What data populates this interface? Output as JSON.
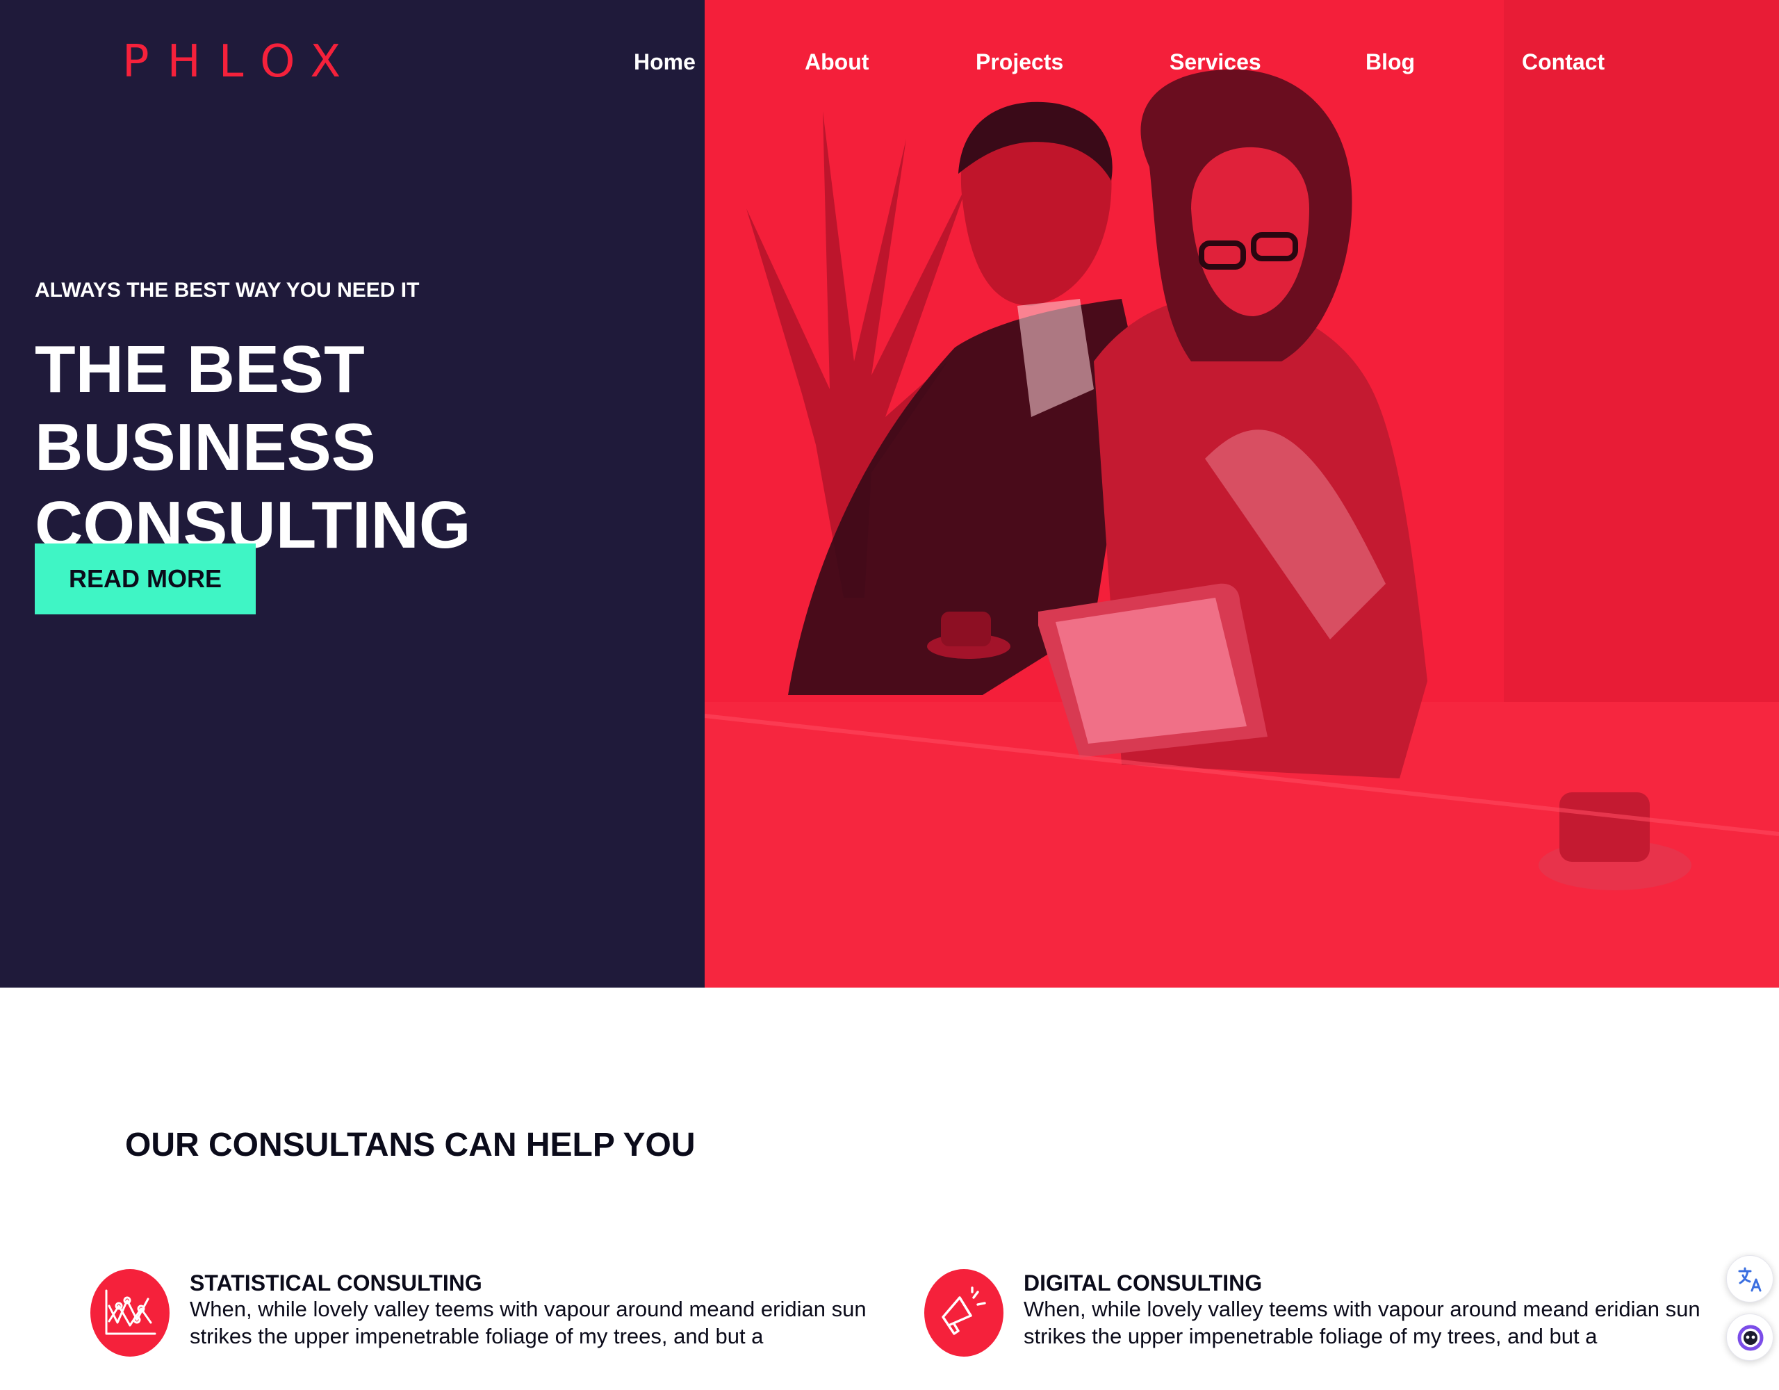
{
  "brand": {
    "logo_text": "PHLOX",
    "accent_color": "#f5213b",
    "dark_color": "#1f1a3a",
    "cta_color": "#3ff5c5"
  },
  "nav": {
    "items": [
      {
        "label": "Home"
      },
      {
        "label": "About"
      },
      {
        "label": "Projects"
      },
      {
        "label": "Services"
      },
      {
        "label": "Blog"
      },
      {
        "label": "Contact"
      }
    ]
  },
  "hero": {
    "eyebrow": "ALWAYS THE BEST WAY YOU NEED IT",
    "headline": "THE BEST BUSINESS CONSULTING",
    "cta_label": "READ MORE",
    "image_alt_icon": "business-meeting-photo"
  },
  "services": {
    "title": "OUR CONSULTANS CAN HELP YOU",
    "items": [
      {
        "icon": "chart-icon",
        "title": "STATISTICAL CONSULTING",
        "text": "When, while lovely valley teems with vapour around meand eridian sun strikes the upper impenetrable foliage of my trees, and but a"
      },
      {
        "icon": "megaphone-icon",
        "title": "DIGITAL CONSULTING",
        "text": "When, while lovely valley teems with vapour around meand eridian sun strikes the upper impenetrable foliage of my trees, and but a"
      }
    ]
  },
  "widgets": {
    "translate_icon": "translate-icon",
    "assistant_icon": "assistant-icon"
  }
}
